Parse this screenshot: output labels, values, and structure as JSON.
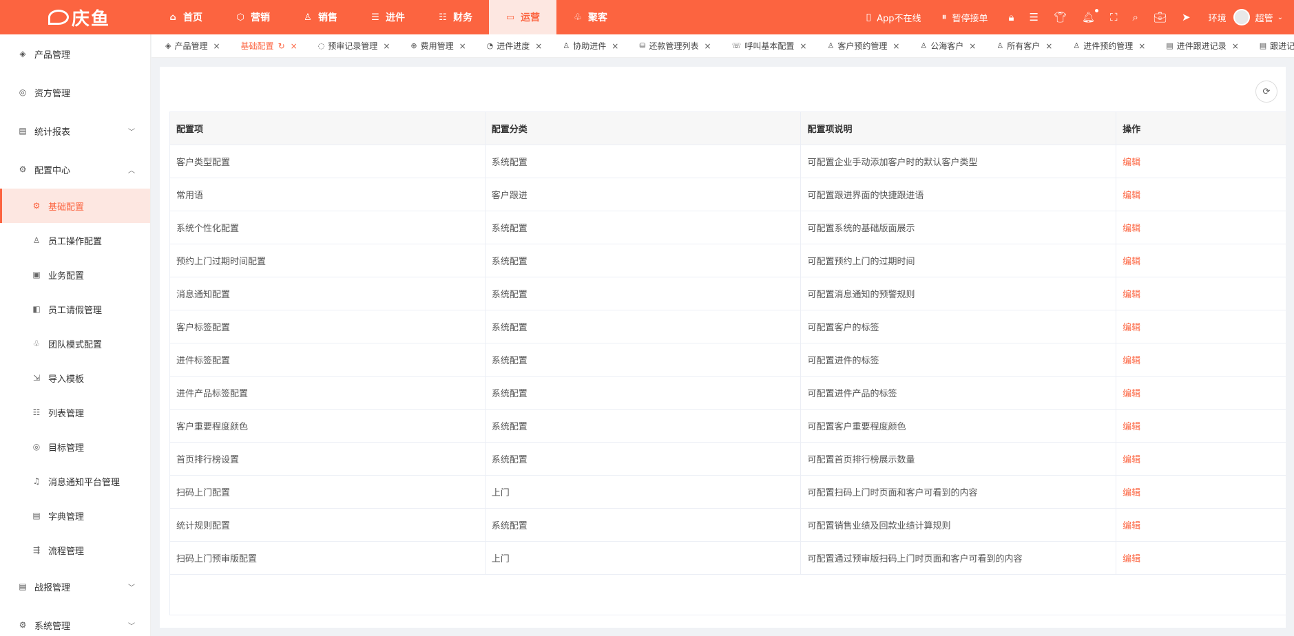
{
  "brand": {
    "name": "庆鱼",
    "accent": "#fc6440"
  },
  "topnav": [
    {
      "label": "首页",
      "icon": "home-icon",
      "glyph": "⌂"
    },
    {
      "label": "营销",
      "icon": "marketing-icon",
      "glyph": "⬡"
    },
    {
      "label": "销售",
      "icon": "sales-icon",
      "glyph": "♙"
    },
    {
      "label": "进件",
      "icon": "intake-icon",
      "glyph": "☰"
    },
    {
      "label": "财务",
      "icon": "finance-icon",
      "glyph": "☷"
    },
    {
      "label": "运营",
      "icon": "operations-icon",
      "glyph": "▭",
      "active": true
    },
    {
      "label": "聚客",
      "icon": "gather-icon",
      "glyph": "♧"
    }
  ],
  "topright": {
    "app_status": "App不在线",
    "pause_label": "暂停接单",
    "env_label": "环境",
    "user_name": "超管"
  },
  "sidebar": {
    "items": [
      {
        "label": "产品管理",
        "icon": "layers-icon",
        "glyph": "◈"
      },
      {
        "label": "资方管理",
        "icon": "capital-icon",
        "glyph": "◎"
      },
      {
        "label": "统计报表",
        "icon": "report-icon",
        "glyph": "▤",
        "chevron": "down"
      },
      {
        "label": "配置中心",
        "icon": "config-icon",
        "glyph": "⚙",
        "chevron": "up"
      }
    ],
    "sub_items": [
      {
        "label": "基础配置",
        "icon": "base-config-icon",
        "glyph": "⚙",
        "active": true
      },
      {
        "label": "员工操作配置",
        "icon": "staff-icon",
        "glyph": "♙"
      },
      {
        "label": "业务配置",
        "icon": "business-icon",
        "glyph": "▣"
      },
      {
        "label": "员工请假管理",
        "icon": "leave-icon",
        "glyph": "◧"
      },
      {
        "label": "团队模式配置",
        "icon": "team-icon",
        "glyph": "♧"
      },
      {
        "label": "导入模板",
        "icon": "import-icon",
        "glyph": "⇲"
      },
      {
        "label": "列表管理",
        "icon": "list-icon",
        "glyph": "☷"
      },
      {
        "label": "目标管理",
        "icon": "target-icon",
        "glyph": "◎"
      },
      {
        "label": "消息通知平台管理",
        "icon": "bell-icon",
        "glyph": "♫"
      },
      {
        "label": "字典管理",
        "icon": "dictionary-icon",
        "glyph": "▤"
      },
      {
        "label": "流程管理",
        "icon": "flow-icon",
        "glyph": "⇶"
      }
    ],
    "bottom_items": [
      {
        "label": "战报管理",
        "icon": "battle-report-icon",
        "glyph": "▤",
        "chevron": "down"
      },
      {
        "label": "系统管理",
        "icon": "system-icon",
        "glyph": "⚙",
        "chevron": "down"
      }
    ]
  },
  "tabs": [
    {
      "label": "产品管理",
      "icon": "layers-icon",
      "glyph": "◈"
    },
    {
      "label": "基础配置",
      "active": true
    },
    {
      "label": "预审记录管理",
      "icon": "audit-icon",
      "glyph": "◌"
    },
    {
      "label": "费用管理",
      "icon": "fee-icon",
      "glyph": "⊕"
    },
    {
      "label": "进件进度",
      "icon": "progress-icon",
      "glyph": "◔"
    },
    {
      "label": "协助进件",
      "icon": "assist-icon",
      "glyph": "♙"
    },
    {
      "label": "还款管理列表",
      "icon": "repay-icon",
      "glyph": "⛁"
    },
    {
      "label": "呼叫基本配置",
      "icon": "phone-icon",
      "glyph": "☏"
    },
    {
      "label": "客户预约管理",
      "icon": "appointment-icon",
      "glyph": "♙"
    },
    {
      "label": "公海客户",
      "icon": "public-customer-icon",
      "glyph": "♙"
    },
    {
      "label": "所有客户",
      "icon": "all-customer-icon",
      "glyph": "♙"
    },
    {
      "label": "进件预约管理",
      "icon": "intake-appointment-icon",
      "glyph": "♙"
    },
    {
      "label": "进件跟进记录",
      "icon": "record-icon",
      "glyph": "▤"
    },
    {
      "label": "跟进记",
      "icon": "record-icon",
      "glyph": "▤"
    }
  ],
  "table": {
    "headers": [
      "配置项",
      "配置分类",
      "配置项说明",
      "操作"
    ],
    "action_label": "编辑",
    "rows": [
      [
        "客户类型配置",
        "系统配置",
        "可配置企业手动添加客户时的默认客户类型"
      ],
      [
        "常用语",
        "客户跟进",
        "可配置跟进界面的快捷跟进语"
      ],
      [
        "系统个性化配置",
        "系统配置",
        "可配置系统的基础版面展示"
      ],
      [
        "预约上门过期时间配置",
        "系统配置",
        "可配置预约上门的过期时间"
      ],
      [
        "消息通知配置",
        "系统配置",
        "可配置消息通知的预警规则"
      ],
      [
        "客户标签配置",
        "系统配置",
        "可配置客户的标签"
      ],
      [
        "进件标签配置",
        "系统配置",
        "可配置进件的标签"
      ],
      [
        "进件产品标签配置",
        "系统配置",
        "可配置进件产品的标签"
      ],
      [
        "客户重要程度颜色",
        "系统配置",
        "可配置客户重要程度颜色"
      ],
      [
        "首页排行榜设置",
        "系统配置",
        "可配置首页排行榜展示数量"
      ],
      [
        "扫码上门配置",
        "上门",
        "可配置扫码上门时页面和客户可看到的内容"
      ],
      [
        "统计规则配置",
        "系统配置",
        "可配置销售业绩及回款业绩计算规则"
      ],
      [
        "扫码上门预审版配置",
        "上门",
        "可配置通过预审版扫码上门时页面和客户可看到的内容"
      ]
    ]
  }
}
